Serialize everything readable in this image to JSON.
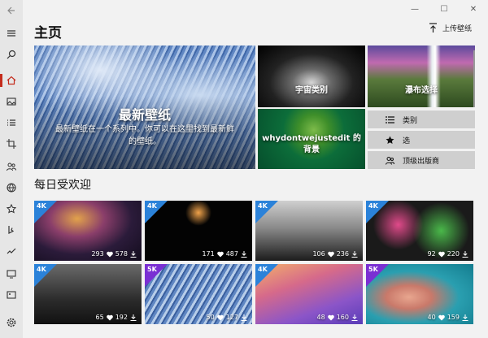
{
  "window": {
    "back_icon": "back-arrow-icon",
    "minimize": "—",
    "maximize": "☐",
    "close": "✕"
  },
  "nav": {
    "items": [
      "menu-icon",
      "search-icon",
      "home-icon",
      "image-icon",
      "list-icon",
      "crop-icon",
      "group-icon",
      "globe-icon",
      "star-icon",
      "bing-icon",
      "trend-icon",
      "monitor-icon",
      "image-2-icon"
    ],
    "settings_icon": "gear-icon"
  },
  "page": {
    "title": "主页",
    "upload_label": "上传壁纸"
  },
  "hero": {
    "big_title": "最新壁纸",
    "big_desc_line1": "最新壁纸在一个系列中。你可以在这里找到最新鲜",
    "big_desc_line2": "的壁纸。",
    "universe": "宇宙类别",
    "waterfall": "瀑布选择",
    "green_line1": "whydontwejustedit 的",
    "green_line2": "背景"
  },
  "side_buttons": [
    {
      "label": "类别",
      "icon": "list-icon"
    },
    {
      "label": "选",
      "icon": "star-icon"
    },
    {
      "label": "顶级出版商",
      "icon": "people-icon"
    }
  ],
  "section": {
    "title": "每日受欢迎"
  },
  "thumbs": [
    {
      "badge": "4K",
      "likes": "293",
      "downloads": "578"
    },
    {
      "badge": "4K",
      "likes": "171",
      "downloads": "487"
    },
    {
      "badge": "4K",
      "likes": "106",
      "downloads": "236"
    },
    {
      "badge": "4K",
      "likes": "92",
      "downloads": "220"
    },
    {
      "badge": "4K",
      "likes": "65",
      "downloads": "192"
    },
    {
      "badge": "5K",
      "likes": "50",
      "downloads": "127"
    },
    {
      "badge": "4K",
      "likes": "48",
      "downloads": "160"
    },
    {
      "badge": "5K",
      "likes": "40",
      "downloads": "159"
    }
  ]
}
